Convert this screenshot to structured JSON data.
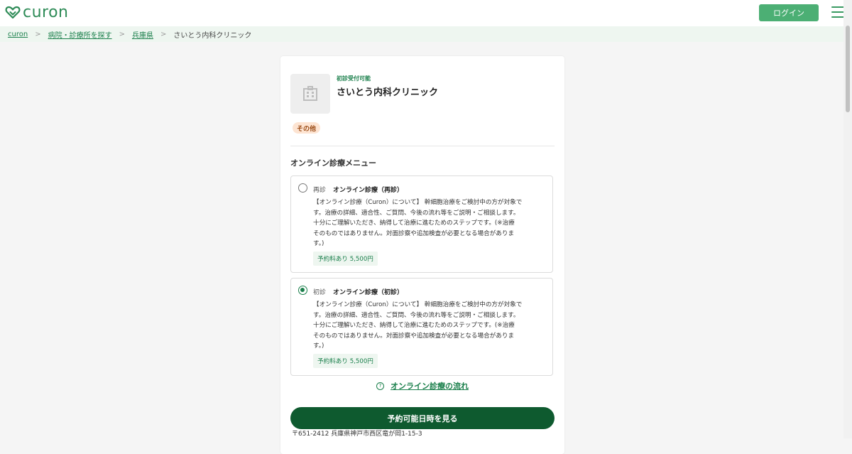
{
  "header": {
    "logo_text": "curon",
    "login_label": "ログイン",
    "brand_color": "#4caf74",
    "icons": {
      "logo": "heart-logo-icon",
      "menu": "hamburger-menu-icon"
    }
  },
  "breadcrumb": {
    "items": [
      "curon",
      "病院・診療所を探す",
      "兵庫県"
    ],
    "current": "さいとう内科クリニック",
    "separator": ">"
  },
  "clinic": {
    "status": "初診受付可能",
    "name": "さいとう内科クリニック",
    "category": "その他",
    "image_icon": "building-icon"
  },
  "menu": {
    "heading": "オンライン診療メニュー",
    "options": [
      {
        "kind": "再診",
        "title": "オンライン診療（再診）",
        "description_lines": [
          "【オンライン診療（Curon）について】 幹細胞治療をご検討中の方が対象で",
          "す。治療の詳細、適合性、ご質問、今後の流れ等をご説明・ご相談します。",
          "十分にご理解いただき、納得して治療に進むためのステップです。(※治療",
          "そのものではありません。対面診察や追加検査が必要となる場合がありま",
          "す。)"
        ],
        "price": "予約料あり 5,500円",
        "selected": false
      },
      {
        "kind": "初診",
        "title": "オンライン診療（初診）",
        "description_lines": [
          "【オンライン診療（Curon）について】 幹細胞治療をご検討中の方が対象で",
          "す。治療の詳細、適合性、ご質問、今後の流れ等をご説明・ご相談します。",
          "十分にご理解いただき、納得して治療に進むためのステップです。(※治療",
          "そのものではありません。対面診察や追加検査が必要となる場合がありま",
          "す。)"
        ],
        "price": "予約料あり 5,500円",
        "selected": true
      }
    ]
  },
  "flow_link": "オンライン診療の流れ",
  "reserve_button": "予約可能日時を見る",
  "address": "〒651-2412 兵庫県神戸市西区竜が岡1-15-3",
  "colors": {
    "primary_dark": "#0e5a2f",
    "link_green": "#1a7f4b",
    "tag_bg": "#fde4d2"
  }
}
